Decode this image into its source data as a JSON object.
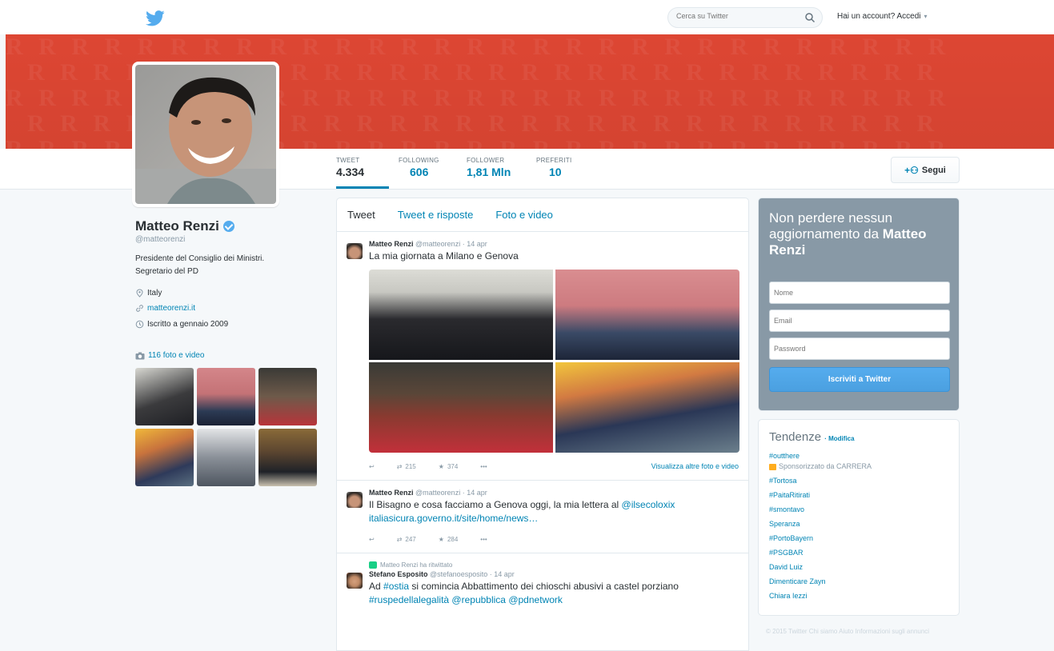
{
  "topbar": {
    "search_placeholder": "Cerca su Twitter",
    "login_label": "Hai un account? Accedi"
  },
  "profile": {
    "name": "Matteo Renzi",
    "handle": "@matteorenzi",
    "bio_line1": "Presidente del Consiglio dei Ministri.",
    "bio_line2": "Segretario del PD",
    "location": "Italy",
    "website": "matteorenzi.it",
    "joined": "Iscritto a gennaio 2009",
    "photos_link": "116 foto e video"
  },
  "stats": [
    {
      "label": "TWEET",
      "value": "4.334"
    },
    {
      "label": "FOLLOWING",
      "value": "606"
    },
    {
      "label": "FOLLOWER",
      "value": "1,81 Mln"
    },
    {
      "label": "PREFERITI",
      "value": "10"
    }
  ],
  "follow_button": "Segui",
  "timeline": {
    "tabs": [
      "Tweet",
      "Tweet e risposte",
      "Foto e video"
    ],
    "tweets": [
      {
        "author": "Matteo Renzi",
        "handle": "@matteorenzi",
        "time": "· 14 apr",
        "text": "La mia giornata a Milano e Genova",
        "retweets": "215",
        "favorites": "374",
        "more_media": "Visualizza altre foto e video"
      },
      {
        "author": "Matteo Renzi",
        "handle": "@matteorenzi",
        "time": "· 14 apr",
        "text_plain": "Il Bisagno e cosa facciamo a Genova oggi, la mia lettera al ",
        "mention": "@ilsecoloxix",
        "link": "italiasicura.governo.it/site/home/news…",
        "retweets": "247",
        "favorites": "284"
      },
      {
        "retweeted_by": "Matteo Renzi ha ritwittato",
        "author": "Stefano Esposito",
        "handle": "@stefanoesposito",
        "time": "· 14 apr",
        "text_pre": "Ad ",
        "hashtag1": "#ostia",
        "text_mid": " si comincia Abbattimento dei chioschi abusivi a castel porziano ",
        "hashtag2": "#ruspedellalegalità",
        "mention1": "@repubblica",
        "mention2": "@pdnetwork"
      }
    ]
  },
  "signup": {
    "heading_pre": "Non perdere nessun aggiornamento da ",
    "heading_name": "Matteo Renzi",
    "name_placeholder": "Nome",
    "email_placeholder": "Email",
    "password_placeholder": "Password",
    "button": "Iscriviti a Twitter"
  },
  "trends": {
    "title": "Tendenze",
    "edit": "· Modifica",
    "first": "#outthere",
    "promoted": "Sponsorizzato da CARRERA",
    "items": [
      "#Tortosa",
      "#PaitaRitirati",
      "#smontavo",
      "Speranza",
      "#PortoBayern",
      "#PSGBAR",
      "David Luiz",
      "Dimenticare Zayn",
      "Chiara Iezzi"
    ]
  },
  "footer": "© 2015 Twitter   Chi siamo   Aiuto   Informazioni sugli annunci",
  "colors": {
    "banner": "#dd4633",
    "link": "#0084b4",
    "signup_bg": "#8899a6",
    "button_blue": "#55acee"
  }
}
